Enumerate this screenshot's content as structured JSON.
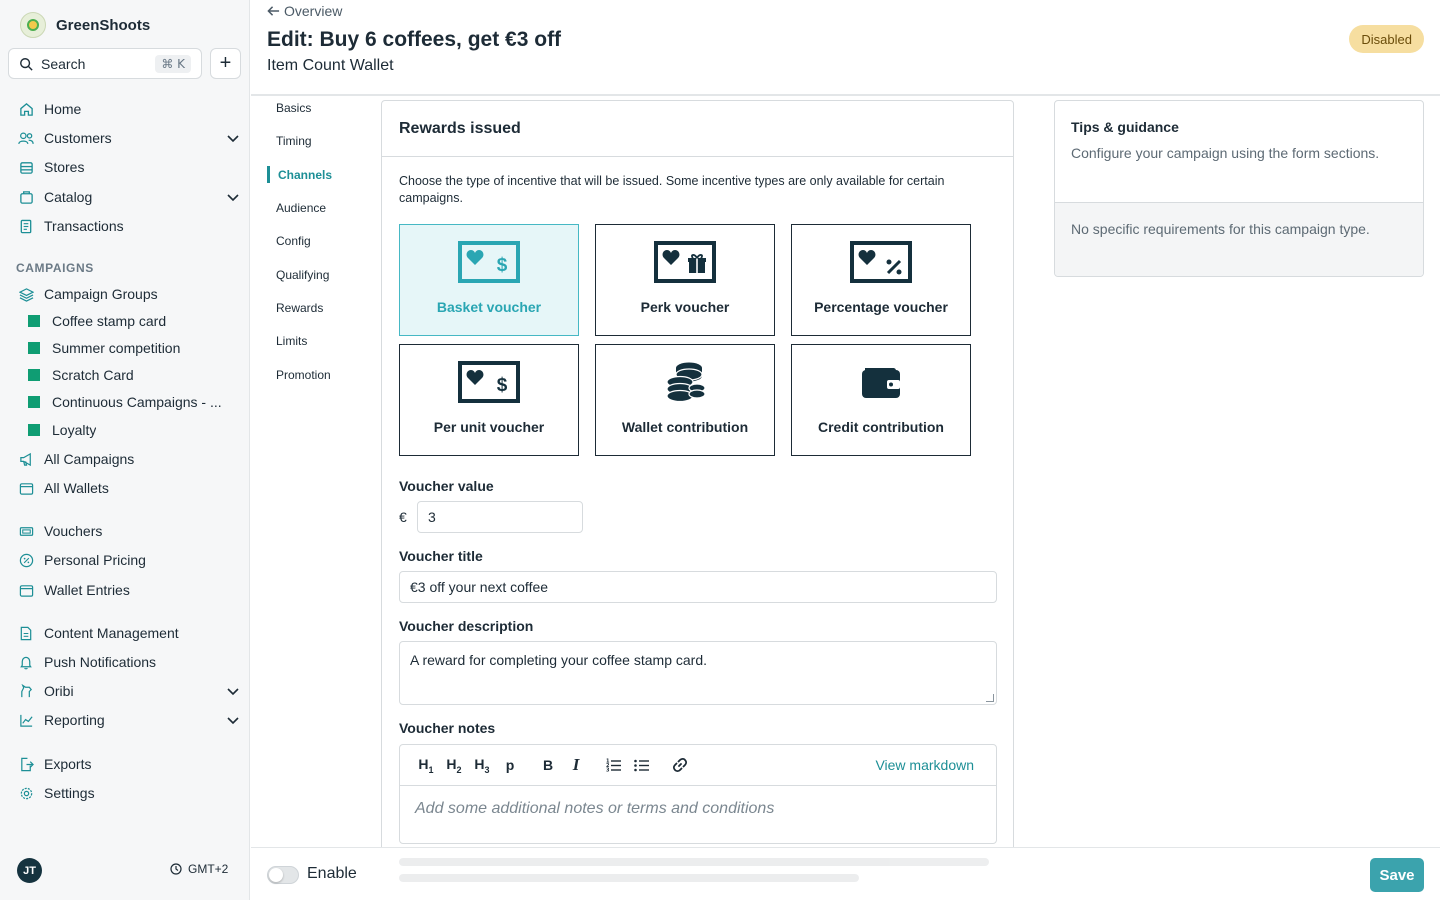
{
  "app": {
    "name": "GreenShoots"
  },
  "search": {
    "label": "Search",
    "shortcut": "⌘ K"
  },
  "sidebar": {
    "nav": [
      {
        "label": "Home",
        "icon": "home-icon"
      },
      {
        "label": "Customers",
        "icon": "users-icon",
        "expandable": true
      },
      {
        "label": "Stores",
        "icon": "store-icon"
      },
      {
        "label": "Catalog",
        "icon": "catalog-icon",
        "expandable": true
      },
      {
        "label": "Transactions",
        "icon": "receipt-icon"
      }
    ],
    "campaigns_heading": "CAMPAIGNS",
    "campaign_groups": {
      "label": "Campaign Groups",
      "icon": "layers-icon"
    },
    "groups": [
      {
        "label": "Coffee stamp card"
      },
      {
        "label": "Summer competition"
      },
      {
        "label": "Scratch Card"
      },
      {
        "label": "Continuous Campaigns - ..."
      },
      {
        "label": "Loyalty"
      }
    ],
    "more": [
      {
        "label": "All Campaigns",
        "icon": "megaphone-icon"
      },
      {
        "label": "All Wallets",
        "icon": "wallet-icon"
      },
      {
        "label": "Vouchers",
        "icon": "ticket-icon"
      },
      {
        "label": "Personal Pricing",
        "icon": "percent-icon"
      },
      {
        "label": "Wallet Entries",
        "icon": "wallet-icon"
      },
      {
        "label": "Content Management",
        "icon": "document-icon"
      },
      {
        "label": "Push Notifications",
        "icon": "bell-icon"
      },
      {
        "label": "Oribi",
        "icon": "oribi-icon",
        "expandable": true
      },
      {
        "label": "Reporting",
        "icon": "chart-icon",
        "expandable": true
      },
      {
        "label": "Exports",
        "icon": "export-icon"
      },
      {
        "label": "Settings",
        "icon": "gear-icon"
      }
    ],
    "user_initials": "JT",
    "timezone": "GMT+2"
  },
  "header": {
    "back_label": "Overview",
    "title": "Edit: Buy 6 coffees, get €3 off",
    "subtitle": "Item Count Wallet",
    "status": "Disabled"
  },
  "section_nav": [
    "Basics",
    "Timing",
    "Channels",
    "Audience",
    "Config",
    "Qualifying",
    "Rewards",
    "Limits",
    "Promotion"
  ],
  "section_nav_active": "Channels",
  "rewards": {
    "heading": "Rewards issued",
    "description": "Choose the type of incentive that will be issued. Some incentive types are only available for certain campaigns.",
    "options": [
      {
        "label": "Basket voucher",
        "icon": "basket-voucher-icon",
        "selected": true
      },
      {
        "label": "Perk voucher",
        "icon": "perk-voucher-icon",
        "selected": false
      },
      {
        "label": "Percentage voucher",
        "icon": "percentage-voucher-icon",
        "selected": false
      },
      {
        "label": "Per unit voucher",
        "icon": "per-unit-voucher-icon",
        "selected": false
      },
      {
        "label": "Wallet contribution",
        "icon": "coins-icon",
        "selected": false
      },
      {
        "label": "Credit contribution",
        "icon": "wallet-icon",
        "selected": false
      }
    ],
    "voucher_value": {
      "label": "Voucher value",
      "currency": "€",
      "value": "3"
    },
    "voucher_title": {
      "label": "Voucher title",
      "value": "€3 off your next coffee"
    },
    "voucher_description": {
      "label": "Voucher description",
      "value": "A reward for completing your coffee stamp card."
    },
    "voucher_notes": {
      "label": "Voucher notes",
      "toolbar": [
        "H1",
        "H2",
        "H3",
        "p",
        "B",
        "I",
        "ordered-list",
        "bullet-list",
        "link"
      ],
      "view_markdown": "View markdown",
      "placeholder": "Add some additional notes or terms and conditions"
    }
  },
  "tips": {
    "title": "Tips & guidance",
    "text": "Configure your campaign using the form sections.",
    "note": "No specific requirements for this campaign type."
  },
  "footer": {
    "enable_label": "Enable",
    "enabled": false,
    "save_label": "Save"
  },
  "colors": {
    "accent": "#1d8f96",
    "save": "#3ba3ad",
    "badge": "#f6dea0",
    "group_square": "#0f9d73",
    "selected_bg": "#e6f6f8"
  }
}
